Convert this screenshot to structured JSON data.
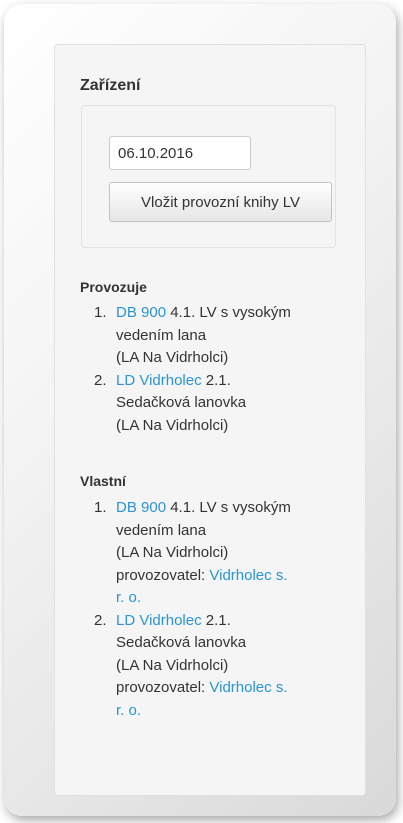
{
  "panel": {
    "title": "Zařízení",
    "date_value": "06.10.2016",
    "add_button_label": "Vložit provozní knihy LV"
  },
  "operates": {
    "heading": "Provozuje",
    "items": [
      {
        "number": "1.",
        "link": "DB 900",
        "desc1": " 4.1. LV s vysokým",
        "desc2": "vedením lana",
        "area": "(LA Na Vidrholci)"
      },
      {
        "number": "2.",
        "link": "LD Vidrholec",
        "desc1": " 2.1.",
        "desc2": "Sedačková lanovka",
        "area": "(LA Na Vidrholci)"
      }
    ]
  },
  "owns": {
    "heading": "Vlastní",
    "items": [
      {
        "number": "1.",
        "link": "DB 900",
        "desc1": " 4.1. LV s vysokým",
        "desc2": "vedením lana",
        "area": "(LA Na Vidrholci)",
        "operator_label": "provozovatel: ",
        "operator_link1": "Vidrholec s.",
        "operator_link2": "r. o."
      },
      {
        "number": "2.",
        "link": "LD Vidrholec",
        "desc1": " 2.1.",
        "desc2": "Sedačková lanovka",
        "area": "(LA Na Vidrholci)",
        "operator_label": "provozovatel: ",
        "operator_link1": "Vidrholec s.",
        "operator_link2": "r. o."
      }
    ]
  },
  "colors": {
    "link": "#2a94d6",
    "text": "#333333",
    "panel_bg": "#f5f5f5"
  }
}
